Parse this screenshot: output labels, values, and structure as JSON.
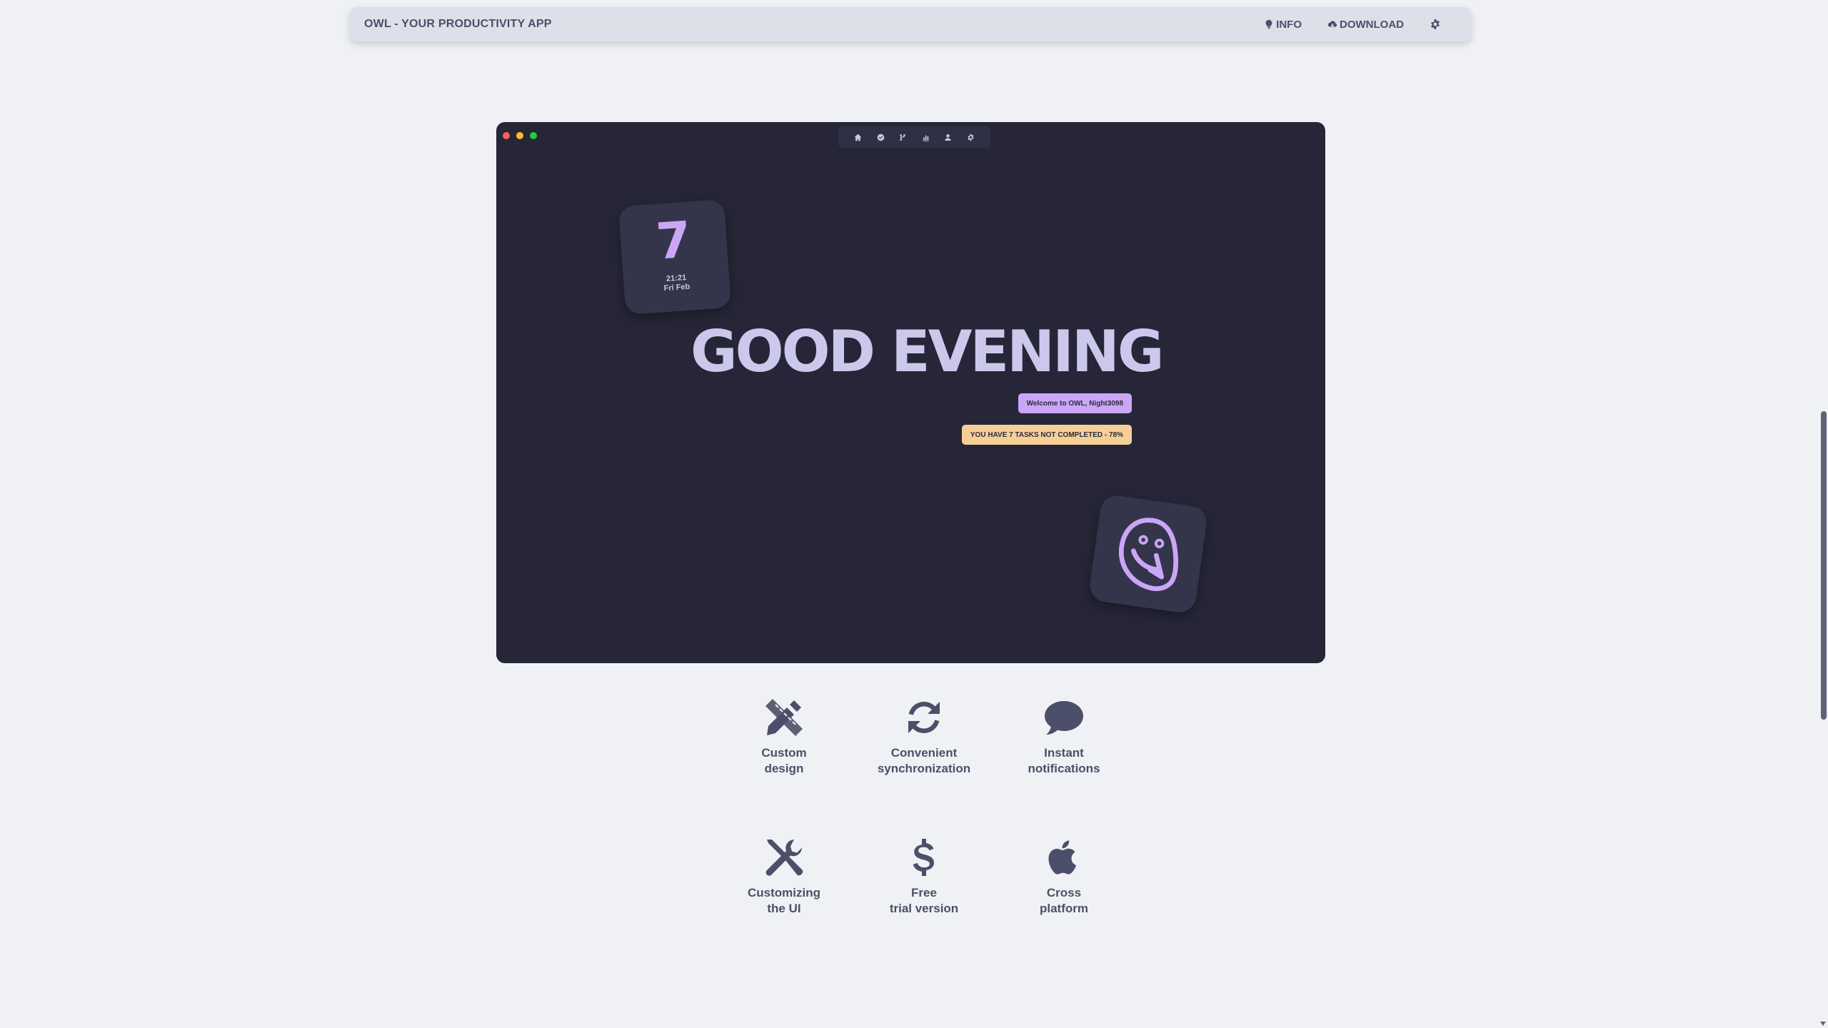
{
  "navbar": {
    "title": "OWL - YOUR PRODUCTIVITY APP",
    "info_label": "INFO",
    "info_icon": "lightbulb-icon",
    "download_label": "DOWNLOAD",
    "download_icon": "cloud-download-icon",
    "settings_icon": "gear-icon"
  },
  "app_preview": {
    "toolbar_icons": [
      "home-icon",
      "check-circle-icon",
      "git-branch-icon",
      "chart-icon",
      "user-icon",
      "gear-icon"
    ],
    "date_card": {
      "day": "7",
      "time": "21:21",
      "date": "Fri Feb"
    },
    "greeting": "GOOD EVENING",
    "welcome": "Welcome to OWL, Night3098",
    "tasks_status": "YOU HAVE 7 TASKS NOT COMPLETED - 78%",
    "logo": "owl-logo-icon"
  },
  "features": [
    {
      "icon": "pencil-ruler-icon",
      "line1": "Custom",
      "line2": "design"
    },
    {
      "icon": "sync-icon",
      "line1": "Convenient",
      "line2": "synchronization"
    },
    {
      "icon": "speech-bubble-icon",
      "line1": "Instant",
      "line2": "notifications"
    },
    {
      "icon": "tools-icon",
      "line1": "Customizing",
      "line2": "the UI"
    },
    {
      "icon": "dollar-icon",
      "line1": "Free",
      "line2": "trial version"
    },
    {
      "icon": "apple-icon",
      "line1": "Cross",
      "line2": "platform"
    }
  ],
  "colors": {
    "page_bg": "#eff1f5",
    "navbar_bg": "#dce0e8",
    "text": "#4c4f69",
    "app_bg": "#262638",
    "accent_purple": "#cba6f7",
    "accent_peach": "#f6cf96",
    "greeting_text": "#ccc8ec"
  }
}
